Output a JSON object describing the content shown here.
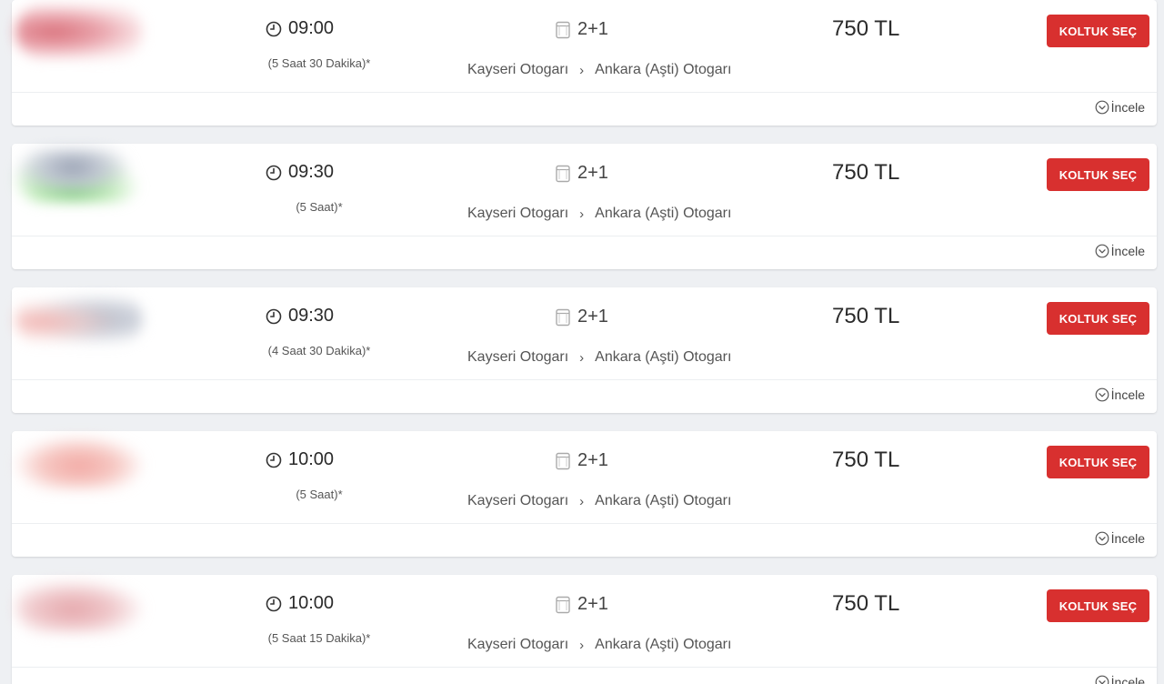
{
  "trips": [
    {
      "time": "09:00",
      "duration": "(5 Saat 30 Dakika)*",
      "seat_layout": "2+1",
      "origin": "Kayseri Otogarı",
      "destination": "Ankara (Aşti) Otogarı",
      "price": "750 TL",
      "button_label": "KOLTUK SEÇ",
      "details_label": "İncele"
    },
    {
      "time": "09:30",
      "duration": "(5 Saat)*",
      "seat_layout": "2+1",
      "origin": "Kayseri Otogarı",
      "destination": "Ankara (Aşti) Otogarı",
      "price": "750 TL",
      "button_label": "KOLTUK SEÇ",
      "details_label": "İncele"
    },
    {
      "time": "09:30",
      "duration": "(4 Saat 30 Dakika)*",
      "seat_layout": "2+1",
      "origin": "Kayseri Otogarı",
      "destination": "Ankara (Aşti) Otogarı",
      "price": "750 TL",
      "button_label": "KOLTUK SEÇ",
      "details_label": "İncele"
    },
    {
      "time": "10:00",
      "duration": "(5 Saat)*",
      "seat_layout": "2+1",
      "origin": "Kayseri Otogarı",
      "destination": "Ankara (Aşti) Otogarı",
      "price": "750 TL",
      "button_label": "KOLTUK SEÇ",
      "details_label": "İncele"
    },
    {
      "time": "10:00",
      "duration": "(5 Saat 15 Dakika)*",
      "seat_layout": "2+1",
      "origin": "Kayseri Otogarı",
      "destination": "Ankara (Aşti) Otogarı",
      "price": "750 TL",
      "button_label": "KOLTUK SEÇ",
      "details_label": "İncele"
    }
  ],
  "route_separator": "›",
  "colors": {
    "accent_button": "#d8302f",
    "page_background": "#eef0f3",
    "card_background": "#ffffff"
  },
  "icons": {
    "time": "clock-icon",
    "seat": "seat-icon",
    "details": "chevron-circle-down-icon"
  }
}
